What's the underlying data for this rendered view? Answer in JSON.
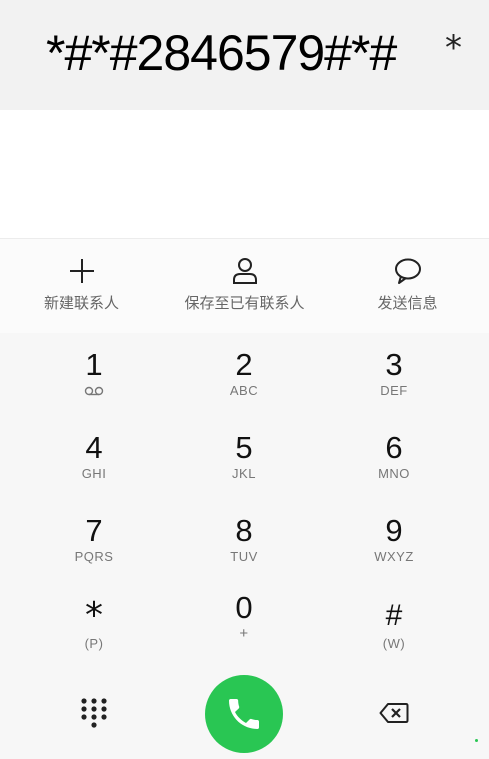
{
  "dialer": {
    "number": "*#*#2846579#*#",
    "trailing": "*"
  },
  "actions": [
    {
      "label": "新建联系人",
      "icon": "plus-icon"
    },
    {
      "label": "保存至已有联系人",
      "icon": "person-icon"
    },
    {
      "label": "发送信息",
      "icon": "message-bubble-icon"
    }
  ],
  "keys": [
    {
      "digit": "1",
      "letters": ""
    },
    {
      "digit": "2",
      "letters": "ABC"
    },
    {
      "digit": "3",
      "letters": "DEF"
    },
    {
      "digit": "4",
      "letters": "GHI"
    },
    {
      "digit": "5",
      "letters": "JKL"
    },
    {
      "digit": "6",
      "letters": "MNO"
    },
    {
      "digit": "7",
      "letters": "PQRS"
    },
    {
      "digit": "8",
      "letters": "TUV"
    },
    {
      "digit": "9",
      "letters": "WXYZ"
    },
    {
      "digit": "*",
      "letters": "(P)"
    },
    {
      "digit": "0",
      "letters": "+"
    },
    {
      "digit": "#",
      "letters": "(W)"
    }
  ],
  "colors": {
    "call_green": "#29c653",
    "action_text": "#666666"
  }
}
